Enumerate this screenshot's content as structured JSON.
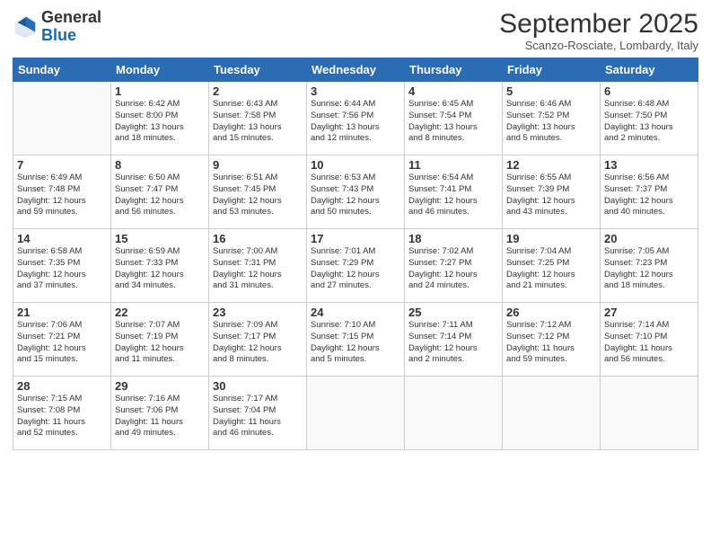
{
  "logo": {
    "general": "General",
    "blue": "Blue"
  },
  "header": {
    "title": "September 2025",
    "subtitle": "Scanzo-Rosciate, Lombardy, Italy"
  },
  "days_of_week": [
    "Sunday",
    "Monday",
    "Tuesday",
    "Wednesday",
    "Thursday",
    "Friday",
    "Saturday"
  ],
  "weeks": [
    [
      {
        "day": "",
        "info": ""
      },
      {
        "day": "1",
        "info": "Sunrise: 6:42 AM\nSunset: 8:00 PM\nDaylight: 13 hours\nand 18 minutes."
      },
      {
        "day": "2",
        "info": "Sunrise: 6:43 AM\nSunset: 7:58 PM\nDaylight: 13 hours\nand 15 minutes."
      },
      {
        "day": "3",
        "info": "Sunrise: 6:44 AM\nSunset: 7:56 PM\nDaylight: 13 hours\nand 12 minutes."
      },
      {
        "day": "4",
        "info": "Sunrise: 6:45 AM\nSunset: 7:54 PM\nDaylight: 13 hours\nand 8 minutes."
      },
      {
        "day": "5",
        "info": "Sunrise: 6:46 AM\nSunset: 7:52 PM\nDaylight: 13 hours\nand 5 minutes."
      },
      {
        "day": "6",
        "info": "Sunrise: 6:48 AM\nSunset: 7:50 PM\nDaylight: 13 hours\nand 2 minutes."
      }
    ],
    [
      {
        "day": "7",
        "info": "Sunrise: 6:49 AM\nSunset: 7:48 PM\nDaylight: 12 hours\nand 59 minutes."
      },
      {
        "day": "8",
        "info": "Sunrise: 6:50 AM\nSunset: 7:47 PM\nDaylight: 12 hours\nand 56 minutes."
      },
      {
        "day": "9",
        "info": "Sunrise: 6:51 AM\nSunset: 7:45 PM\nDaylight: 12 hours\nand 53 minutes."
      },
      {
        "day": "10",
        "info": "Sunrise: 6:53 AM\nSunset: 7:43 PM\nDaylight: 12 hours\nand 50 minutes."
      },
      {
        "day": "11",
        "info": "Sunrise: 6:54 AM\nSunset: 7:41 PM\nDaylight: 12 hours\nand 46 minutes."
      },
      {
        "day": "12",
        "info": "Sunrise: 6:55 AM\nSunset: 7:39 PM\nDaylight: 12 hours\nand 43 minutes."
      },
      {
        "day": "13",
        "info": "Sunrise: 6:56 AM\nSunset: 7:37 PM\nDaylight: 12 hours\nand 40 minutes."
      }
    ],
    [
      {
        "day": "14",
        "info": "Sunrise: 6:58 AM\nSunset: 7:35 PM\nDaylight: 12 hours\nand 37 minutes."
      },
      {
        "day": "15",
        "info": "Sunrise: 6:59 AM\nSunset: 7:33 PM\nDaylight: 12 hours\nand 34 minutes."
      },
      {
        "day": "16",
        "info": "Sunrise: 7:00 AM\nSunset: 7:31 PM\nDaylight: 12 hours\nand 31 minutes."
      },
      {
        "day": "17",
        "info": "Sunrise: 7:01 AM\nSunset: 7:29 PM\nDaylight: 12 hours\nand 27 minutes."
      },
      {
        "day": "18",
        "info": "Sunrise: 7:02 AM\nSunset: 7:27 PM\nDaylight: 12 hours\nand 24 minutes."
      },
      {
        "day": "19",
        "info": "Sunrise: 7:04 AM\nSunset: 7:25 PM\nDaylight: 12 hours\nand 21 minutes."
      },
      {
        "day": "20",
        "info": "Sunrise: 7:05 AM\nSunset: 7:23 PM\nDaylight: 12 hours\nand 18 minutes."
      }
    ],
    [
      {
        "day": "21",
        "info": "Sunrise: 7:06 AM\nSunset: 7:21 PM\nDaylight: 12 hours\nand 15 minutes."
      },
      {
        "day": "22",
        "info": "Sunrise: 7:07 AM\nSunset: 7:19 PM\nDaylight: 12 hours\nand 11 minutes."
      },
      {
        "day": "23",
        "info": "Sunrise: 7:09 AM\nSunset: 7:17 PM\nDaylight: 12 hours\nand 8 minutes."
      },
      {
        "day": "24",
        "info": "Sunrise: 7:10 AM\nSunset: 7:15 PM\nDaylight: 12 hours\nand 5 minutes."
      },
      {
        "day": "25",
        "info": "Sunrise: 7:11 AM\nSunset: 7:14 PM\nDaylight: 12 hours\nand 2 minutes."
      },
      {
        "day": "26",
        "info": "Sunrise: 7:12 AM\nSunset: 7:12 PM\nDaylight: 11 hours\nand 59 minutes."
      },
      {
        "day": "27",
        "info": "Sunrise: 7:14 AM\nSunset: 7:10 PM\nDaylight: 11 hours\nand 56 minutes."
      }
    ],
    [
      {
        "day": "28",
        "info": "Sunrise: 7:15 AM\nSunset: 7:08 PM\nDaylight: 11 hours\nand 52 minutes."
      },
      {
        "day": "29",
        "info": "Sunrise: 7:16 AM\nSunset: 7:06 PM\nDaylight: 11 hours\nand 49 minutes."
      },
      {
        "day": "30",
        "info": "Sunrise: 7:17 AM\nSunset: 7:04 PM\nDaylight: 11 hours\nand 46 minutes."
      },
      {
        "day": "",
        "info": ""
      },
      {
        "day": "",
        "info": ""
      },
      {
        "day": "",
        "info": ""
      },
      {
        "day": "",
        "info": ""
      }
    ]
  ]
}
